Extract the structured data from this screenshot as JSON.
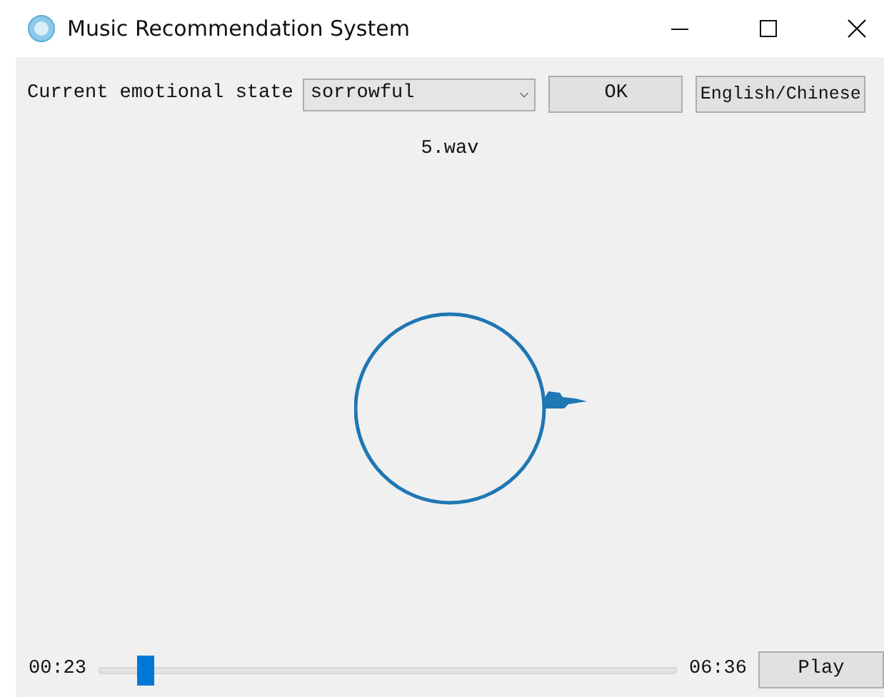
{
  "window": {
    "title": "Music Recommendation System"
  },
  "emotion": {
    "label": "Current emotional state",
    "value": "sorrowful",
    "caret": "⌵"
  },
  "buttons": [
    {
      "label": "OK"
    },
    {
      "label": "English/Chinese"
    }
  ],
  "file_name": "5.wav",
  "player": {
    "elapsed": "00:23",
    "level": 0.08,
    "total": "06:36",
    "play_label": "Play"
  }
}
